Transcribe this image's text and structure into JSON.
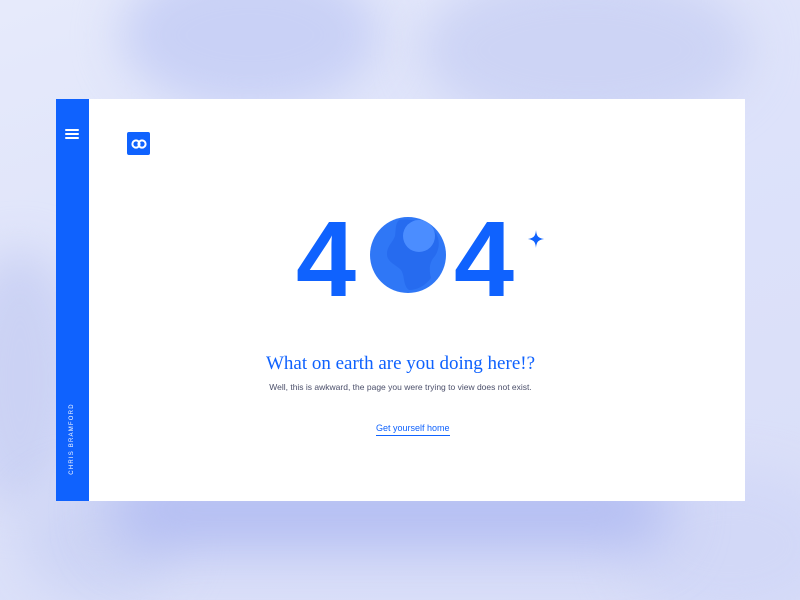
{
  "theme": {
    "accent": "#0f62fe",
    "globe_light": "#4b8dff",
    "globe_mid": "#2f77f6",
    "background": "#dfe4fb"
  },
  "sidebar": {
    "menu_icon": "hamburger-menu-icon",
    "author": "CHRIS BRAMFORD"
  },
  "brand": {
    "logo_icon": "link-logo-icon"
  },
  "error": {
    "digit_left": "4",
    "digit_right": "4",
    "middle_icon": "earth-globe-icon",
    "accent_icon": "sparkle-star-icon",
    "headline": "What on earth are you doing here!?",
    "message": "Well, this is awkward, the page you were trying to view does not exist.",
    "home_link": "Get yourself home"
  }
}
